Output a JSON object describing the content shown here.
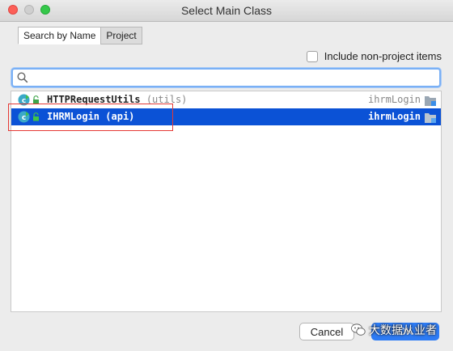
{
  "window": {
    "title": "Select Main Class"
  },
  "tabs": [
    {
      "label": "Search by Name",
      "active": true
    },
    {
      "label": "Project",
      "active": false
    }
  ],
  "include_checkbox": {
    "label": "Include non-project items",
    "checked": false
  },
  "search": {
    "value": "",
    "placeholder": "",
    "icon": "search-icon"
  },
  "results": [
    {
      "class_name": "HTTPRequestUtils",
      "package": "(utils)",
      "module": "ihrmLogin",
      "selected": false
    },
    {
      "class_name": "IHRMLogin",
      "package": "(api)",
      "module": "ihrmLogin",
      "selected": true
    }
  ],
  "buttons": {
    "cancel": "Cancel",
    "ok": "OK"
  },
  "watermark": {
    "text": "大数据从业者"
  },
  "colors": {
    "selection": "#0b52d6",
    "focus_ring": "#7ab0f5",
    "annotation": "#e53935",
    "primary_button": "#2d7bf4"
  }
}
